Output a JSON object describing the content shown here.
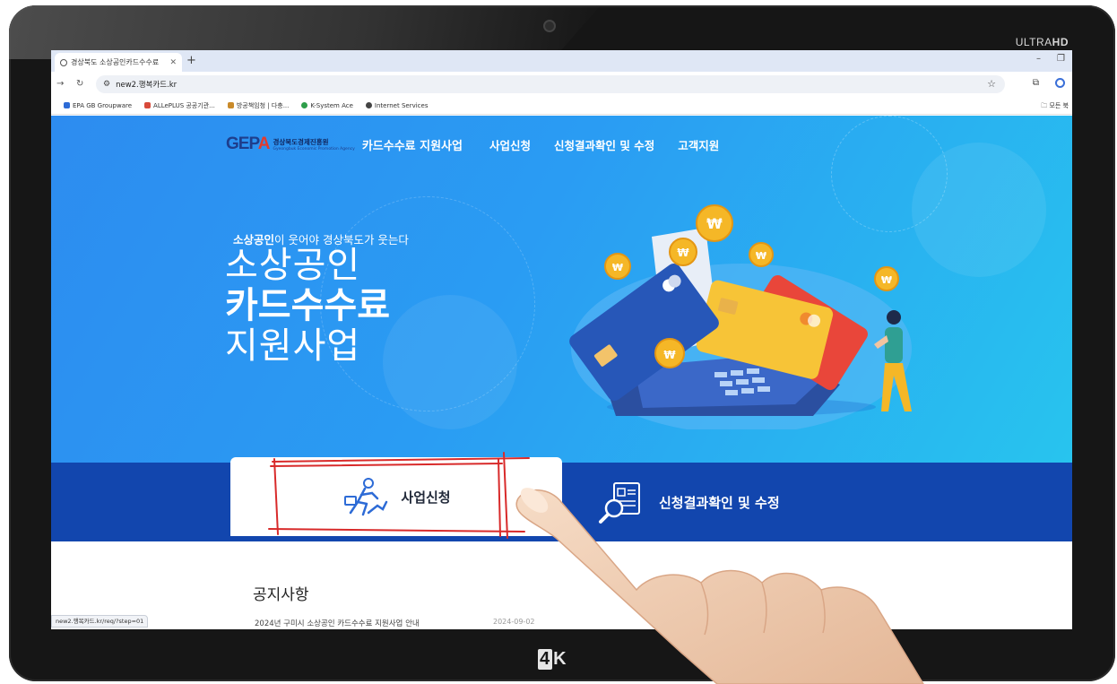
{
  "monitor": {
    "brand_top": "ULTRAHD",
    "brand_top_plain": "ULTRA",
    "brand_top_bold": "HD",
    "brand_bottom": "4K",
    "brand_bottom_a": "4",
    "brand_bottom_b": "K"
  },
  "browser": {
    "tab_title": "경상북도 소상공인카드수수료",
    "new_tab": "+",
    "url": "new2.행복카드.kr",
    "bookmarks": [
      {
        "label": "EPA GB Groupware",
        "color": "#2d6bd6"
      },
      {
        "label": "ALLePLUS 공공기관...",
        "color": "#d84a3a"
      },
      {
        "label": "방공책임청 | 다충...",
        "color": "#c98a2a"
      },
      {
        "label": "K-System Ace",
        "color": "#2e9e4a"
      },
      {
        "label": "Internet Services",
        "color": "#444444"
      }
    ],
    "bookmarks_all": "모든 북",
    "status_url": "new2.행복카드.kr/req/?step=01"
  },
  "site": {
    "logo_mark": "GEP",
    "logo_mark_accent": "A",
    "logo_ko": "경상북도경제진흥원",
    "logo_en": "Gyeongbuk Economic Promotion Agency",
    "title": "카드수수료 지원사업",
    "menu": [
      "사업신청",
      "신청결과확인 및 수정",
      "고객지원"
    ],
    "hero_sub_bold": "소상공인",
    "hero_sub_rest": "이 웃어야 경상북도가 웃는다",
    "hero_line1": "소상공인",
    "hero_line2": "카드수수료",
    "hero_line3": "지원사업",
    "apply_tab": "사업신청",
    "result_tab": "신청결과확인 및 수정",
    "notice_title": "공지사항",
    "notice_items": [
      {
        "title": "2024년 구미시 소상공인 카드수수료 지원사업 안내",
        "date": "2024-09-02"
      }
    ]
  },
  "colors": {
    "hero_start": "#2d8cf0",
    "hero_end": "#28c4ee",
    "band": "#1246ae",
    "annotation": "#d82a2a",
    "bezel": "#161616"
  }
}
